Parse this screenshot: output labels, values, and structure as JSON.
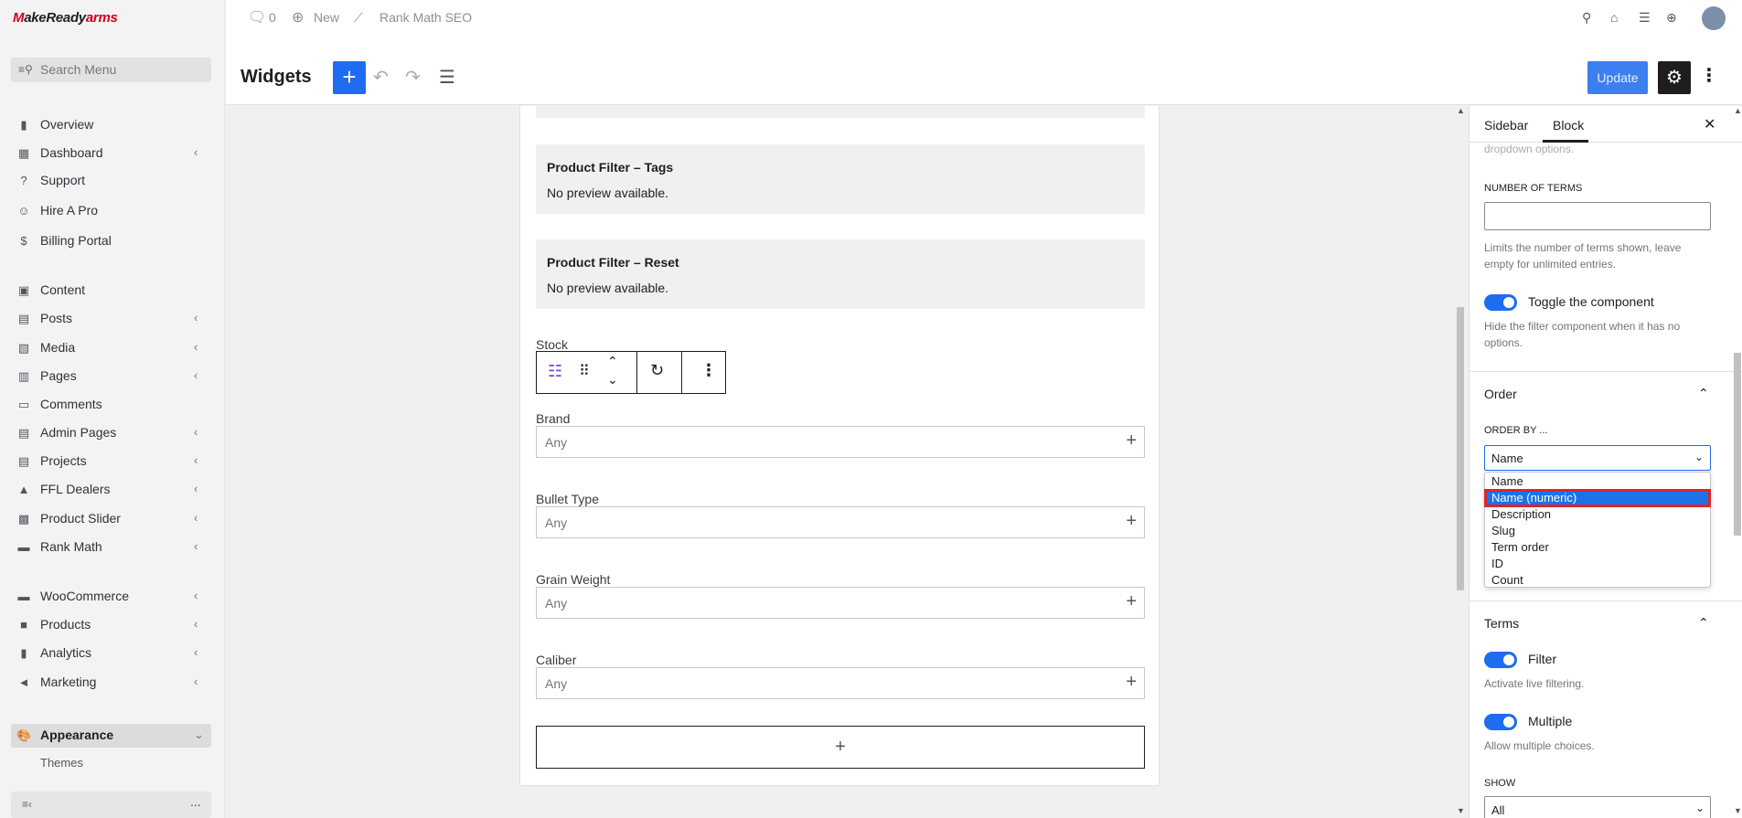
{
  "brand": {
    "logo_prefix": "M",
    "logo_mid": "akeReady",
    "logo_suffix": "arms"
  },
  "sidebar": {
    "search_placeholder": "Search Menu",
    "items": [
      {
        "label": "Overview",
        "icon": "chart-bars-icon",
        "has_chevron": false
      },
      {
        "label": "Dashboard",
        "icon": "grid-icon",
        "has_chevron": true
      },
      {
        "label": "Support",
        "icon": "help-circle-icon",
        "has_chevron": false
      },
      {
        "label": "Hire A Pro",
        "icon": "person-icon",
        "has_chevron": false
      },
      {
        "label": "Billing Portal",
        "icon": "dollar-icon",
        "has_chevron": false
      },
      {
        "label": "Content",
        "icon": "image-icon",
        "has_chevron": false
      },
      {
        "label": "Posts",
        "icon": "document-icon",
        "has_chevron": true
      },
      {
        "label": "Media",
        "icon": "media-icon",
        "has_chevron": true
      },
      {
        "label": "Pages",
        "icon": "page-icon",
        "has_chevron": true
      },
      {
        "label": "Comments",
        "icon": "comment-icon",
        "has_chevron": false
      },
      {
        "label": "Admin Pages",
        "icon": "admin-page-icon",
        "has_chevron": true
      },
      {
        "label": "Projects",
        "icon": "project-icon",
        "has_chevron": true
      },
      {
        "label": "FFL Dealers",
        "icon": "dealer-icon",
        "has_chevron": true
      },
      {
        "label": "Product Slider",
        "icon": "slider-icon",
        "has_chevron": true
      },
      {
        "label": "Rank Math",
        "icon": "rankmath-icon",
        "has_chevron": true
      },
      {
        "label": "WooCommerce",
        "icon": "woo-icon",
        "has_chevron": true
      },
      {
        "label": "Products",
        "icon": "box-icon",
        "has_chevron": true
      },
      {
        "label": "Analytics",
        "icon": "chart-bars-icon",
        "has_chevron": true
      },
      {
        "label": "Marketing",
        "icon": "megaphone-icon",
        "has_chevron": true
      }
    ],
    "appearance": {
      "label": "Appearance",
      "submenu": [
        "Themes"
      ]
    },
    "collapse_icon": "collapse-menu-icon",
    "more_label": "..."
  },
  "topbar": {
    "comments_count": "0",
    "new_label": "New",
    "rankmath_label": "Rank Math SEO"
  },
  "editor": {
    "title": "Widgets",
    "add_label": "+",
    "update_label": "Update"
  },
  "canvas": {
    "blocks": [
      {
        "title": "Product Filter – Tags",
        "sub": "No preview available."
      },
      {
        "title": "Product Filter – Reset",
        "sub": "No preview available."
      }
    ],
    "stock_label": "Stock",
    "fields": [
      {
        "label": "Brand",
        "placeholder": "Any"
      },
      {
        "label": "Bullet Type",
        "placeholder": "Any"
      },
      {
        "label": "Grain Weight",
        "placeholder": "Any"
      },
      {
        "label": "Caliber",
        "placeholder": "Any"
      }
    ],
    "add_block": "+"
  },
  "inspector": {
    "tabs": [
      "Sidebar",
      "Block"
    ],
    "clipped_help": "Determines the height of the dropdown options.",
    "clipped_help_line2": "dropdown options.",
    "number_of_terms_label": "NUMBER OF TERMS",
    "number_of_terms_value": "",
    "number_help_1": "Limits the number of terms shown, leave",
    "number_help_2": "empty for unlimited entries.",
    "toggle_component_label": "Toggle the component",
    "toggle_help_1": "Hide the filter component when it has no",
    "toggle_help_2": "options.",
    "order_title": "Order",
    "order_by_label": "ORDER BY ...",
    "order_by_value": "Name",
    "order_options": [
      "Name",
      "Name (numeric)",
      "Description",
      "Slug",
      "Term order",
      "ID",
      "Count"
    ],
    "order_highlighted": "Name (numeric)",
    "terms_title": "Terms",
    "filter_label": "Filter",
    "filter_help": "Activate live filtering.",
    "multiple_label": "Multiple",
    "multiple_help": "Allow multiple choices.",
    "show_label": "SHOW",
    "show_value": "All"
  },
  "colors": {
    "accent": "#1e6cf0",
    "highlight_outline": "#e02424",
    "dark": "#1e1e1e"
  }
}
